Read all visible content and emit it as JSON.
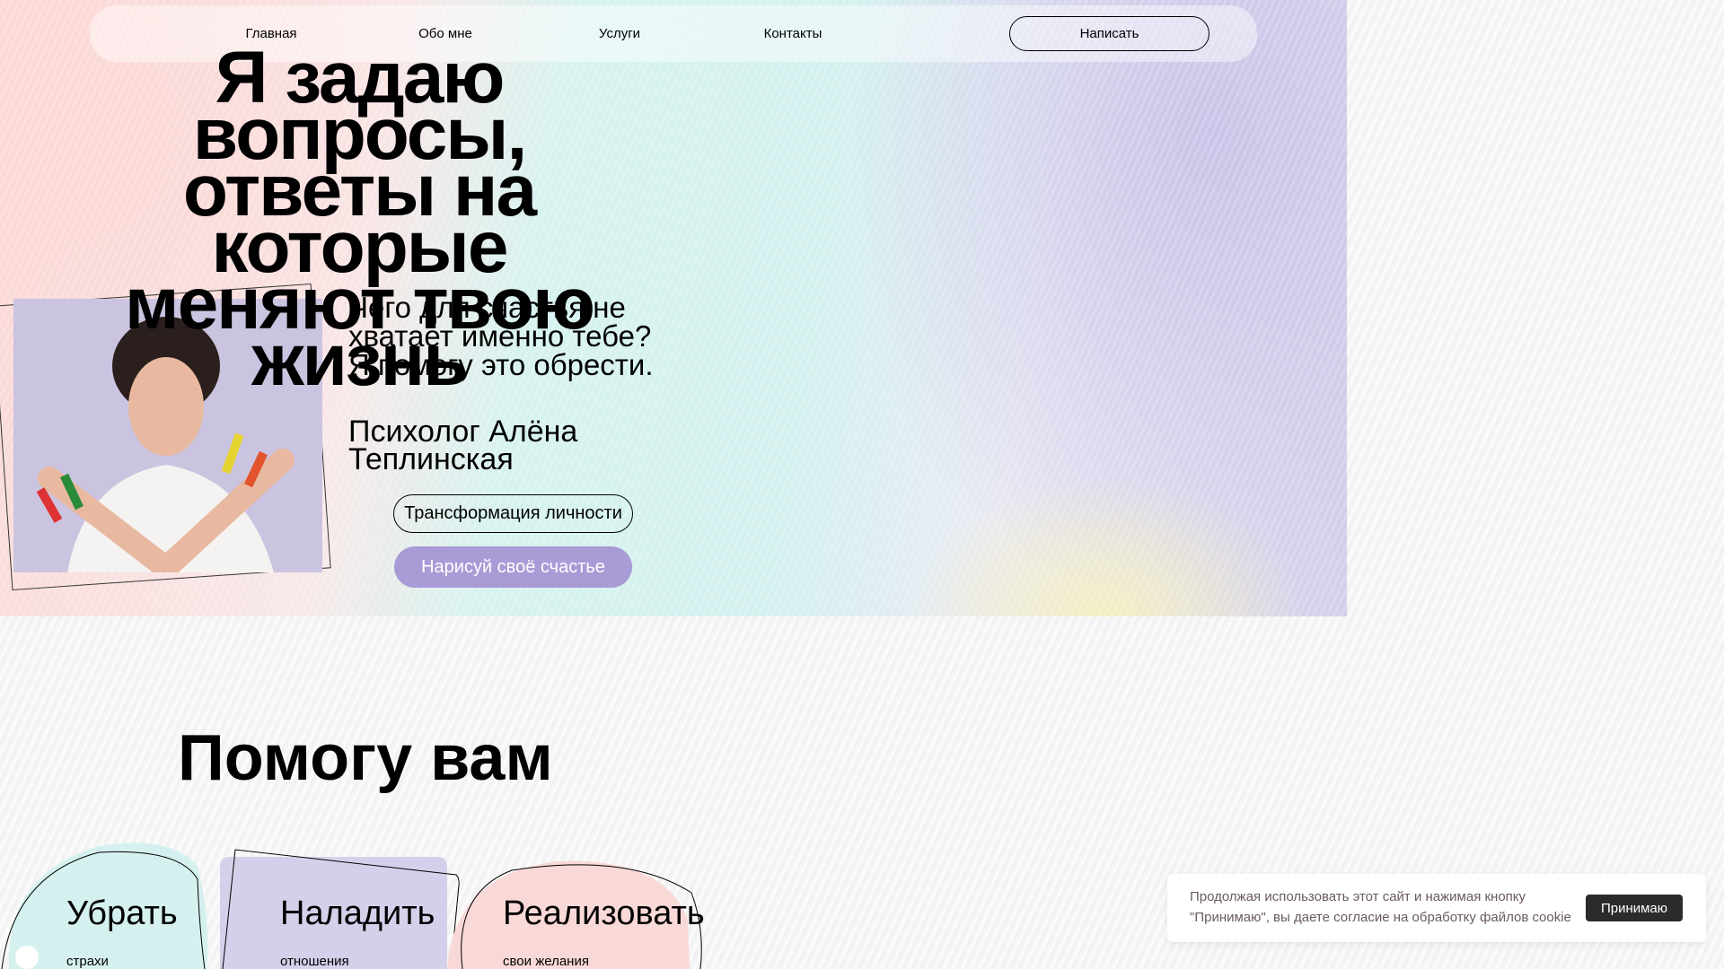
{
  "nav": {
    "items": [
      "Главная",
      "Обо мне",
      "Услуги",
      "Контакты"
    ],
    "cta": "Написать"
  },
  "hero": {
    "headline": [
      "Я задаю",
      "вопросы,",
      "ответы на",
      "которые",
      "меняют твою",
      "жизнь"
    ],
    "subtitle": [
      "Чего для счастья не",
      "хватает именно тебе?",
      "Я помогу это обрести."
    ],
    "name": [
      "Психолог Алёна",
      "Теплинская"
    ],
    "button_transform": "Трансформация личности",
    "button_draw": "Нарисуй своё счастье"
  },
  "help": {
    "title": "Помогу вам",
    "cards": [
      {
        "title": "Убрать",
        "subtitle": "страхи"
      },
      {
        "title": "Наладить",
        "subtitle": "отношения"
      },
      {
        "title": "Реализовать",
        "subtitle": "свои желания"
      }
    ]
  },
  "cookie": {
    "text_line1": "Продолжая использовать этот сайт и нажимая кнопку",
    "text_line2": "\"Принимаю\", вы даете согласие на обработку файлов cookie",
    "accept": "Принимаю"
  },
  "colors": {
    "accent": "#a99bd6",
    "teal": "#d4f1ef",
    "pink": "#fad8d6",
    "lavender": "#d2cfe9"
  }
}
